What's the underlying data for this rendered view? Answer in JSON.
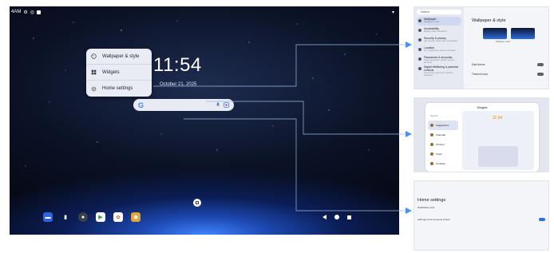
{
  "status": {
    "time": "4AM"
  },
  "home": {
    "clock": "11:54",
    "date": "October 21, 2025"
  },
  "context_menu": {
    "items": [
      {
        "label": "Wallpaper & style",
        "icon": "palette-icon"
      },
      {
        "label": "Widgets",
        "icon": "widgets-icon"
      },
      {
        "label": "Home settings",
        "icon": "gear-icon"
      }
    ]
  },
  "search": {
    "logo": "G"
  },
  "dock": {
    "apps": [
      "chat-icon",
      "files-icon",
      "camera-icon",
      "play-store-icon",
      "photos-icon",
      "app-icon"
    ]
  },
  "panel_wallpaper": {
    "search_placeholder": "Search",
    "title": "Wallpaper & style",
    "sidebar": [
      {
        "title": "Wallpaper",
        "sub": "Wallpaper & style"
      },
      {
        "title": "Accessibility",
        "sub": "Display, audio, interaction"
      },
      {
        "title": "Security & privacy",
        "sub": "App security, device lock, permissions"
      },
      {
        "title": "Location",
        "sub": "On - 4 apps have access to location"
      },
      {
        "title": "Passwords & accounts",
        "sub": "Saved passwords, autofill, synced accounts"
      },
      {
        "title": "Digital Wellbeing & parental controls",
        "sub": "Screen time, app timers, bedtime schedules"
      }
    ],
    "rows": [
      {
        "label": "Dark theme"
      },
      {
        "label": "Themed icons"
      }
    ],
    "sub_label": "Wallpaper colors"
  },
  "panel_widgets": {
    "title": "Widgets",
    "search_placeholder": "Search",
    "clock": "11:54",
    "list": [
      "Suggestions",
      "Calendar",
      "Chrome",
      "Clock",
      "Contacts",
      "Drive"
    ]
  },
  "panel_home": {
    "title": "Home settings",
    "lines": [
      {
        "label": "Notification dots"
      },
      {
        "label": "Add app icons to Home screen"
      }
    ]
  }
}
